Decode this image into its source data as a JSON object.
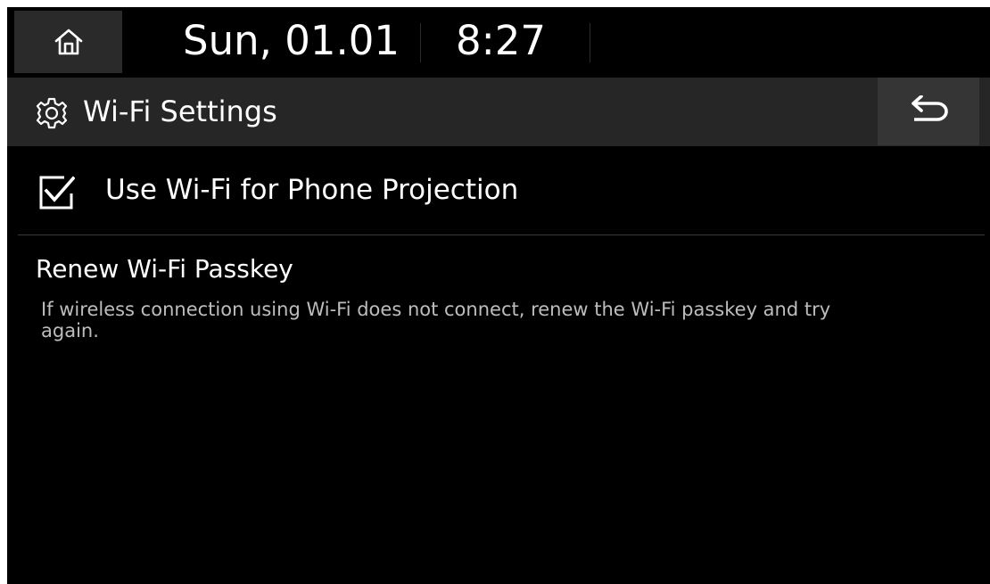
{
  "status_bar": {
    "date": "Sun, 01.01",
    "time": "8:27",
    "home_icon": "home-icon"
  },
  "header": {
    "title": "Wi-Fi Settings",
    "title_icon": "gear-icon",
    "back_icon": "back-arrow-icon"
  },
  "options": {
    "phone_projection": {
      "label": "Use Wi-Fi for Phone Projection",
      "checked": true
    }
  },
  "renew_passkey": {
    "title": "Renew Wi-Fi Passkey",
    "description": "If wireless connection using Wi-Fi does not connect, renew the Wi-Fi passkey and try again."
  },
  "colors": {
    "background": "#000000",
    "title_bar": "#262626",
    "button": "#2a2a2a",
    "text_primary": "#ffffff",
    "text_secondary": "#bdbdbd"
  }
}
